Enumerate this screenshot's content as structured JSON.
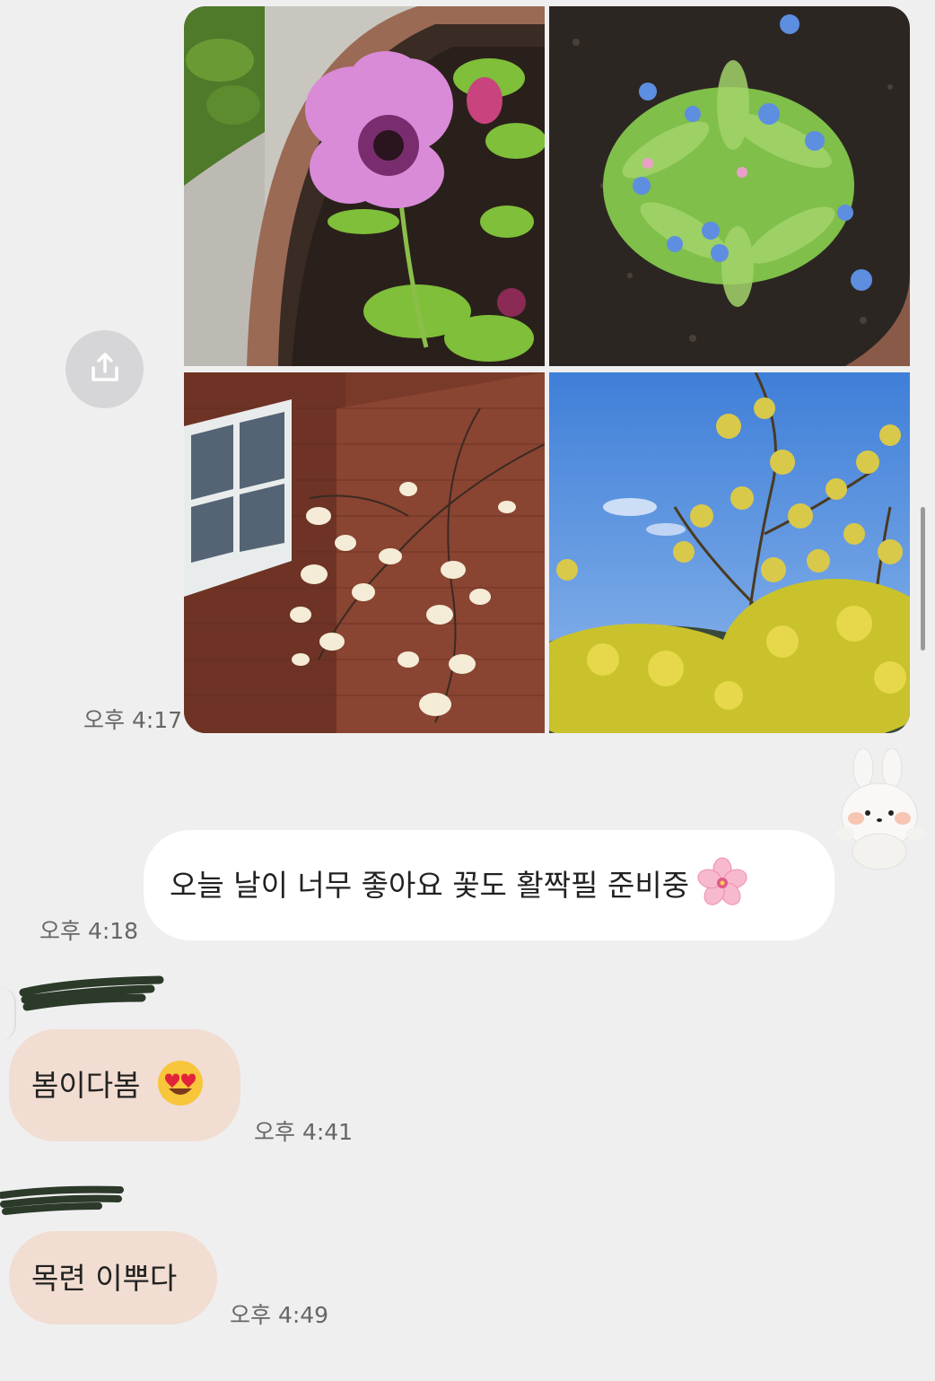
{
  "chat": {
    "photo_message": {
      "time": "오후 4:17",
      "photos": [
        {
          "alt": "purple anemone flower in a pot"
        },
        {
          "alt": "blue forget-me-not flowers in soil"
        },
        {
          "alt": "white magnolia blossoms against brick wall"
        },
        {
          "alt": "yellow forsythia and cornus under blue sky"
        }
      ]
    },
    "my_message": {
      "text": "오늘 날이 너무 좋아요 꽃도 활짝필 준비중",
      "emoji": "cherry-blossom",
      "time": "오후 4:18"
    },
    "replies": [
      {
        "text": "봄이다봄",
        "emoji": "heart-eyes",
        "time": "오후 4:41"
      },
      {
        "text": "목련 이뿌다",
        "time": "오후 4:49"
      }
    ]
  },
  "colors": {
    "background": "#efeff0",
    "my_bubble": "#ffffff",
    "their_bubble": "#f1ddd1",
    "timestamp": "#666666"
  }
}
